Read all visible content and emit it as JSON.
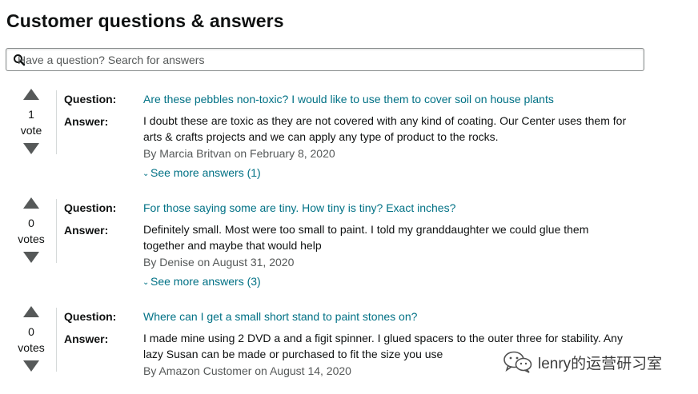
{
  "header": {
    "title": "Customer questions & answers"
  },
  "search": {
    "placeholder": "Have a question? Search for answers"
  },
  "labels": {
    "question": "Question:",
    "answer": "Answer:"
  },
  "qas": [
    {
      "votes": "1",
      "vote_label": "vote",
      "question": "Are these pebbles non-toxic? I would like to use them to cover soil on house plants",
      "answer_lines": [
        "I doubt these are toxic as they are not covered with any kind of coating. Our Center uses them for",
        "arts & crafts projects and we can apply any type of product to the rocks."
      ],
      "byline": "By Marcia Britvan on February 8, 2020",
      "more": "See more answers (1)"
    },
    {
      "votes": "0",
      "vote_label": "votes",
      "question": "For those saying some are tiny. How tiny is tiny? Exact inches?",
      "answer_lines": [
        "Definitely small. Most were too small to paint. I told my granddaughter we could glue them",
        "together and maybe that would help"
      ],
      "byline": "By Denise on August 31, 2020",
      "more": "See more answers (3)"
    },
    {
      "votes": "0",
      "vote_label": "votes",
      "question": "Where can I get a small short stand to paint stones on?",
      "answer_lines": [
        "I made mine using 2 DVD a and a figit spinner. I glued spacers to the outer three for stability. Any",
        "lazy Susan can be made or purchased to fit the size you use"
      ],
      "byline": "By Amazon Customer on August 14, 2020"
    }
  ],
  "watermark": {
    "text": "lenry的运营研习室"
  },
  "icons": {
    "search": "search-icon",
    "upvote": "triangle-up-icon",
    "downvote": "triangle-down-icon",
    "more": "chevron-down-icon"
  },
  "colors": {
    "link": "#007185",
    "byline": "#565959",
    "arrow": "#565959"
  }
}
